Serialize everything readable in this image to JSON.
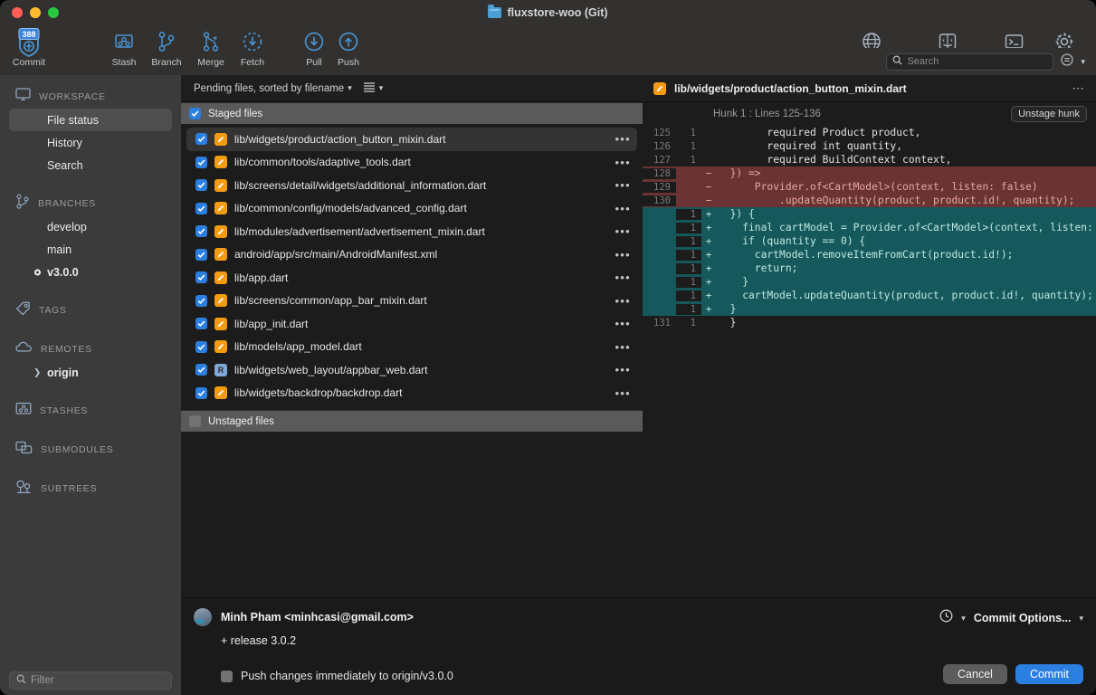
{
  "window": {
    "title": "fluxstore-woo (Git)",
    "folder_icon": "folder-icon"
  },
  "toolbar": {
    "items": [
      {
        "label": "Commit",
        "icon": "commit-shield-icon",
        "badge": "388"
      },
      {
        "label": "Stash",
        "icon": "stash-icon"
      },
      {
        "label": "Branch",
        "icon": "branch-icon"
      },
      {
        "label": "Merge",
        "icon": "merge-icon"
      },
      {
        "label": "Fetch",
        "icon": "fetch-down-arrow-dashed-icon"
      },
      {
        "label": "Pull",
        "icon": "pull-down-arrow-icon"
      },
      {
        "label": "Push",
        "icon": "push-up-arrow-icon"
      }
    ],
    "right_items": [
      {
        "label": "View Remote",
        "icon": "globe-icon"
      },
      {
        "label": "Show in Finder",
        "icon": "finder-icon"
      },
      {
        "label": "Terminal",
        "icon": "terminal-icon"
      },
      {
        "label": "Settings",
        "icon": "gear-icon"
      }
    ]
  },
  "sidebar": {
    "sections": [
      {
        "title": "WORKSPACE",
        "icon": "monitor-icon",
        "items": [
          {
            "label": "File status",
            "selected": true
          },
          {
            "label": "History",
            "selected": false
          },
          {
            "label": "Search",
            "selected": false
          }
        ]
      },
      {
        "title": "BRANCHES",
        "icon": "branch-icon",
        "items": [
          {
            "label": "develop",
            "current": false
          },
          {
            "label": "main",
            "current": false
          },
          {
            "label": "v3.0.0",
            "current": true
          }
        ]
      },
      {
        "title": "TAGS",
        "icon": "tag-icon",
        "items": []
      },
      {
        "title": "REMOTES",
        "icon": "cloud-icon",
        "items": [
          {
            "label": "origin",
            "expandable": true
          }
        ]
      },
      {
        "title": "STASHES",
        "icon": "stash-icon",
        "items": []
      },
      {
        "title": "SUBMODULES",
        "icon": "submodule-icon",
        "items": []
      },
      {
        "title": "SUBTREES",
        "icon": "subtree-icon",
        "items": []
      }
    ],
    "filter": {
      "placeholder": "Filter",
      "value": "",
      "icon": "search-icon"
    }
  },
  "file_list": {
    "sort_label": "Pending files, sorted by filename",
    "sort_chevron": "chevron-down-icon",
    "view_icon": "list-view-icon",
    "view_chevron": "chevron-down-icon",
    "staged_header": {
      "label": "Staged files",
      "checked": true
    },
    "unstaged_header": {
      "label": "Unstaged files",
      "checked": false
    },
    "rows": [
      {
        "path": "lib/widgets/product/action_button_mixin.dart",
        "status": "modified",
        "status_glyph": "",
        "checked": true,
        "selected": true
      },
      {
        "path": "lib/common/tools/adaptive_tools.dart",
        "status": "modified",
        "status_glyph": "",
        "checked": true,
        "selected": false
      },
      {
        "path": "lib/screens/detail/widgets/additional_information.dart",
        "status": "modified",
        "status_glyph": "",
        "checked": true,
        "selected": false
      },
      {
        "path": "lib/common/config/models/advanced_config.dart",
        "status": "modified",
        "status_glyph": "",
        "checked": true,
        "selected": false
      },
      {
        "path": "lib/modules/advertisement/advertisement_mixin.dart",
        "status": "modified",
        "status_glyph": "",
        "checked": true,
        "selected": false
      },
      {
        "path": "android/app/src/main/AndroidManifest.xml",
        "status": "modified",
        "status_glyph": "",
        "checked": true,
        "selected": false
      },
      {
        "path": "lib/app.dart",
        "status": "modified",
        "status_glyph": "",
        "checked": true,
        "selected": false
      },
      {
        "path": "lib/screens/common/app_bar_mixin.dart",
        "status": "modified",
        "status_glyph": "",
        "checked": true,
        "selected": false
      },
      {
        "path": "lib/app_init.dart",
        "status": "modified",
        "status_glyph": "",
        "checked": true,
        "selected": false
      },
      {
        "path": "lib/models/app_model.dart",
        "status": "modified",
        "status_glyph": "",
        "checked": true,
        "selected": false
      },
      {
        "path": "lib/widgets/web_layout/appbar_web.dart",
        "status": "renamed",
        "status_glyph": "R",
        "checked": true,
        "selected": false
      },
      {
        "path": "lib/widgets/backdrop/backdrop.dart",
        "status": "modified",
        "status_glyph": "",
        "checked": true,
        "selected": false
      }
    ],
    "row_menu_glyph": "•••"
  },
  "search": {
    "placeholder": "Search",
    "value": "",
    "icon": "search-icon",
    "options_icon": "options-icon",
    "chevron": "chevron-down-icon"
  },
  "diff": {
    "file_path": "lib/widgets/product/action_button_mixin.dart",
    "status": "modified",
    "menu_glyph": "•••",
    "hunk_label": "Hunk 1 : Lines 125-136",
    "unstage_button": "Unstage hunk",
    "lines": [
      {
        "old": "125",
        "new": "1",
        "sign": "",
        "type": "ctx",
        "text": "        required Product product,"
      },
      {
        "old": "126",
        "new": "1",
        "sign": "",
        "type": "ctx",
        "text": "        required int quantity,"
      },
      {
        "old": "127",
        "new": "1",
        "sign": "",
        "type": "ctx",
        "text": "        required BuildContext context,"
      },
      {
        "old": "128",
        "new": "",
        "sign": "−",
        "type": "del",
        "text": "  }) =>"
      },
      {
        "old": "129",
        "new": "",
        "sign": "−",
        "type": "del",
        "text": "      Provider.of<CartModel>(context, listen: false)"
      },
      {
        "old": "130",
        "new": "",
        "sign": "−",
        "type": "del",
        "text": "          .updateQuantity(product, product.id!, quantity);"
      },
      {
        "old": "",
        "new": "1",
        "sign": "+",
        "type": "add",
        "text": "  }) {"
      },
      {
        "old": "",
        "new": "1",
        "sign": "+",
        "type": "add",
        "text": "    final cartModel = Provider.of<CartModel>(context, listen: false);"
      },
      {
        "old": "",
        "new": "1",
        "sign": "+",
        "type": "add",
        "text": "    if (quantity == 0) {"
      },
      {
        "old": "",
        "new": "1",
        "sign": "+",
        "type": "add",
        "text": "      cartModel.removeItemFromCart(product.id!);"
      },
      {
        "old": "",
        "new": "1",
        "sign": "+",
        "type": "add",
        "text": "      return;"
      },
      {
        "old": "",
        "new": "1",
        "sign": "+",
        "type": "add",
        "text": "    }"
      },
      {
        "old": "",
        "new": "1",
        "sign": "+",
        "type": "add",
        "text": "    cartModel.updateQuantity(product, product.id!, quantity);"
      },
      {
        "old": "",
        "new": "1",
        "sign": "+",
        "type": "add",
        "text": "  }"
      },
      {
        "old": "131",
        "new": "1",
        "sign": "",
        "type": "ctx",
        "text": "  }"
      }
    ]
  },
  "commit": {
    "author": "Minh Pham <minhcasi@gmail.com>",
    "message": "+ release 3.0.2",
    "push_checkbox_label": "Push changes immediately to origin/v3.0.0",
    "push_checked": false,
    "clock_icon": "clock-icon",
    "clock_chevron": "chevron-down-icon",
    "options_label": "Commit Options...",
    "options_chevron": "chevron-down-icon",
    "cancel_label": "Cancel",
    "commit_label": "Commit"
  },
  "colors": {
    "accent_blue": "#2b7fe0",
    "modified_orange": "#f39c12",
    "renamed_blue": "#7fa8d8",
    "diff_add": "#16595c",
    "diff_del": "#6b3434",
    "icon_blue": "#5b9fd4"
  }
}
